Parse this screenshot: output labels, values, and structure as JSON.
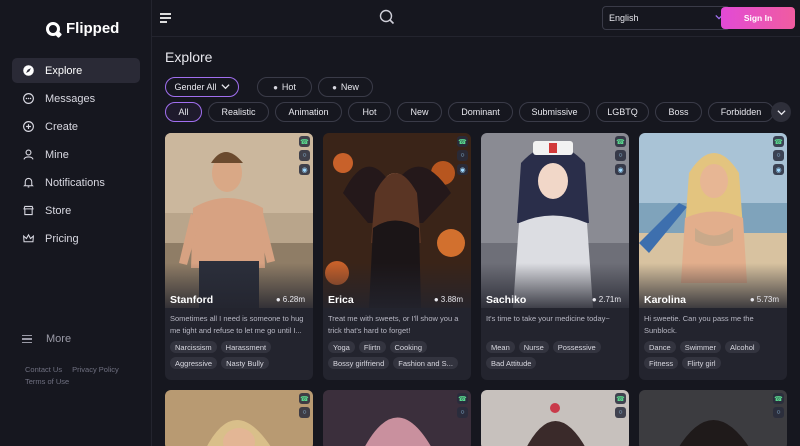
{
  "app": {
    "name": "Flipped"
  },
  "sidebar": {
    "items": [
      {
        "label": "Explore",
        "icon": "compass-icon",
        "active": true
      },
      {
        "label": "Messages",
        "icon": "chat-icon"
      },
      {
        "label": "Create",
        "icon": "plus-circle-icon"
      },
      {
        "label": "Mine",
        "icon": "user-icon"
      },
      {
        "label": "Notifications",
        "icon": "bell-icon"
      },
      {
        "label": "Store",
        "icon": "store-icon"
      },
      {
        "label": "Pricing",
        "icon": "crown-icon"
      }
    ],
    "more_label": "More",
    "links": {
      "contact": "Contact Us",
      "privacy": "Privacy Policy",
      "terms": "Terms of Use"
    }
  },
  "header": {
    "language": "English",
    "signin_label": "Sign In"
  },
  "main": {
    "title": "Explore",
    "filters": {
      "gender": "Gender All",
      "hot": "Hot",
      "new": "New"
    },
    "categories": [
      "All",
      "Realistic",
      "Animation",
      "Hot",
      "New",
      "Dominant",
      "Submissive",
      "LGBTQ",
      "Boss",
      "Forbidden"
    ],
    "cards": [
      {
        "name": "Stanford",
        "count": "6.28m",
        "desc": "Sometimes all I need is someone to hug me tight and refuse to let me go until I...",
        "tags": [
          "Narcissism",
          "Harassment",
          "Aggressive",
          "Nasty Bully"
        ]
      },
      {
        "name": "Erica",
        "count": "3.88m",
        "desc": "Treat me with sweets, or I'll show you a trick that's hard to forget!",
        "tags": [
          "Yoga",
          "Flirtn",
          "Cooking",
          "Bossy girlfriend",
          "Fashion and S..."
        ]
      },
      {
        "name": "Sachiko",
        "count": "2.71m",
        "desc": "It's time to take your medicine today~",
        "tags": [
          "Mean",
          "Nurse",
          "Possessive",
          "Bad Attitude"
        ]
      },
      {
        "name": "Karolina",
        "count": "5.73m",
        "desc": "Hi sweetie. Can you pass me the Sunblock.",
        "tags": [
          "Dance",
          "Swimmer",
          "Alcohol",
          "Fitness",
          "Flirty girl"
        ]
      }
    ]
  },
  "colors": {
    "accent": "#a16ff0",
    "signin_gradient_start": "#e24ad6",
    "signin_gradient_end": "#f05ca0",
    "background": "#16171f"
  }
}
